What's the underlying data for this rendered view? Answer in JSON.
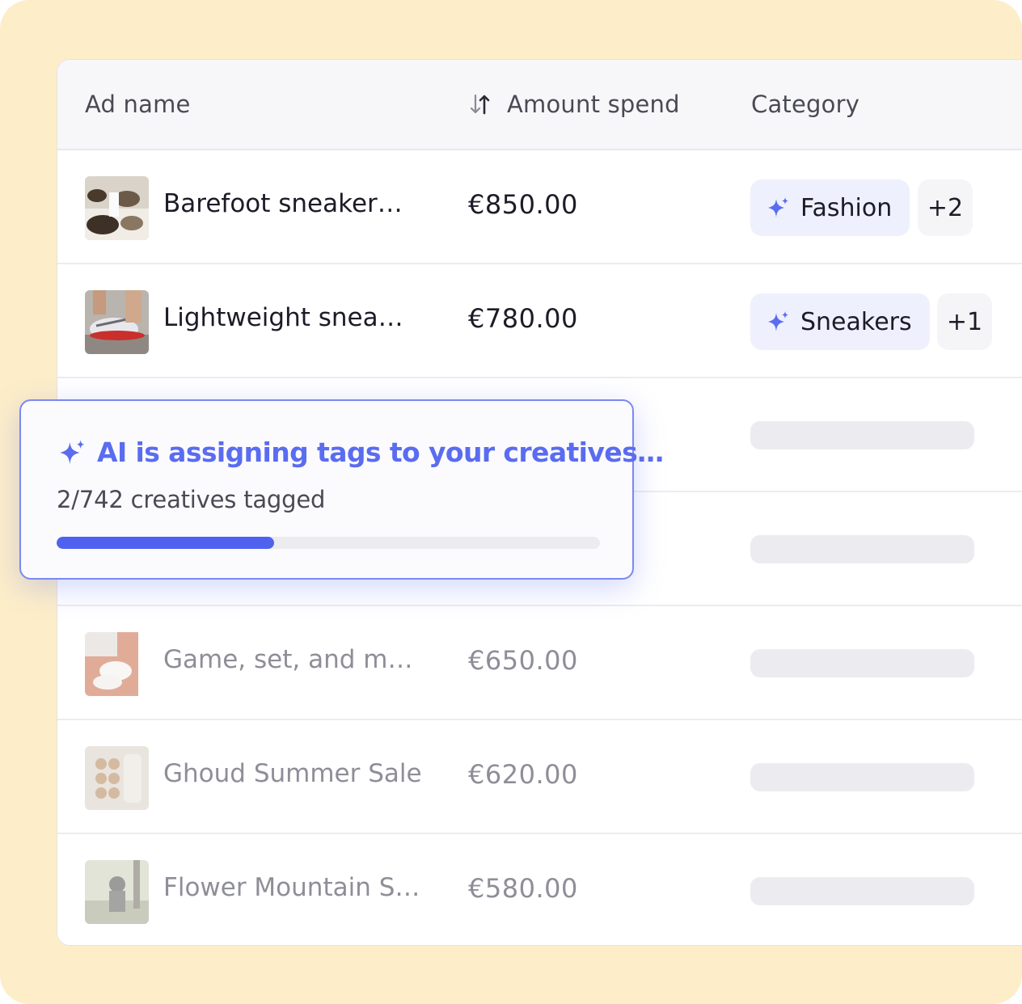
{
  "table": {
    "columns": {
      "ad_name": "Ad name",
      "amount": "Amount spend",
      "category": "Category"
    },
    "rows": [
      {
        "name": "Barefoot sneaker…",
        "amount": "€850.00",
        "tag": "Fashion",
        "more": "+2",
        "state": "tagged"
      },
      {
        "name": "Lightweight snea…",
        "amount": "€780.00",
        "tag": "Sneakers",
        "more": "+1",
        "state": "tagged"
      },
      {
        "name": "",
        "amount": "",
        "state": "loading"
      },
      {
        "name": "",
        "amount": "",
        "state": "loading"
      },
      {
        "name": "Game, set, and m…",
        "amount": "€650.00",
        "state": "loading"
      },
      {
        "name": "Ghoud Summer Sale",
        "amount": "€620.00",
        "state": "loading"
      },
      {
        "name": "Flower Mountain S…",
        "amount": "€580.00",
        "state": "loading"
      }
    ]
  },
  "popup": {
    "title": "AI is assigning tags to your creatives…",
    "subtitle": "2/742 creatives tagged",
    "progress": 0.4
  },
  "icons": {
    "sort": "sort-arrows-icon",
    "sparkle": "sparkle-icon"
  },
  "colors": {
    "background": "#fdeec9",
    "accent": "#5a6cf0",
    "tag_bg": "#eef1fd",
    "progress": "#4f62ef"
  }
}
